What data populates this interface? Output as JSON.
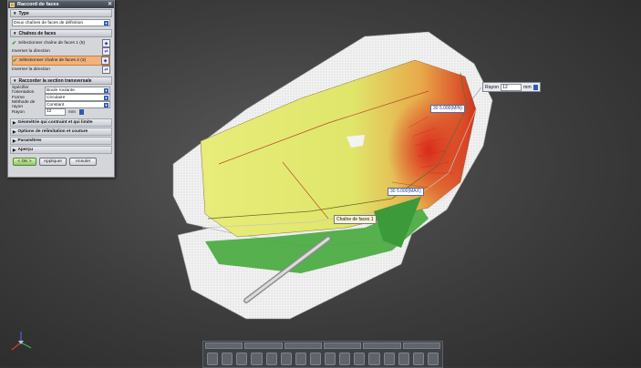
{
  "dialog": {
    "title": "Raccord de faces",
    "close_glyph": "✕",
    "sections": {
      "type": {
        "title": "Type",
        "value": "Deux chaînes de faces de définition"
      },
      "chains": {
        "title": "Chaînes de faces",
        "select1": "Sélectionner chaîne de faces 1 (5)",
        "invert1": "Inverser la direction",
        "select2": "Sélectionner chaîne de faces 2 (3)",
        "invert2": "Inverser la direction"
      },
      "cross": {
        "title": "Raccorder la section transversale",
        "orientation_label": "Spécifier l'orientation",
        "orientation_value": "Boule roulante",
        "shape_label": "Forme",
        "shape_value": "Circulaire",
        "method_label": "Méthode de rayon",
        "method_value": "Constant",
        "radius_label": "Rayon",
        "radius_value": "12",
        "radius_unit": "mm"
      }
    },
    "collapsed": [
      "Géométrie qui contraint et qui limite",
      "Options de relimitation et couture",
      "Paramètres",
      "Aperçu"
    ],
    "buttons": {
      "ok": "< OK >",
      "apply": "Appliquer",
      "cancel": "Annuler"
    }
  },
  "viewport": {
    "rayon_label": "Rayon",
    "rayon_value": "12",
    "rayon_unit": "mm",
    "min_label_value": "30",
    "min_label_text": "5.000(MIN)",
    "max_label_value": "30",
    "max_label_text": "5.000(MAX)",
    "tooltip": "Chaîne de faces 1"
  },
  "colors": {
    "accent": "#2c5cb0",
    "highlight_row": "#f1b27d",
    "surface_yellow": "#e6e96a",
    "surface_green": "#3fa43a",
    "surface_red": "#d22a1a"
  },
  "icons": [
    "check-icon",
    "dropdown-icon",
    "select-face-icon",
    "direction-icon",
    "compass-icon"
  ]
}
